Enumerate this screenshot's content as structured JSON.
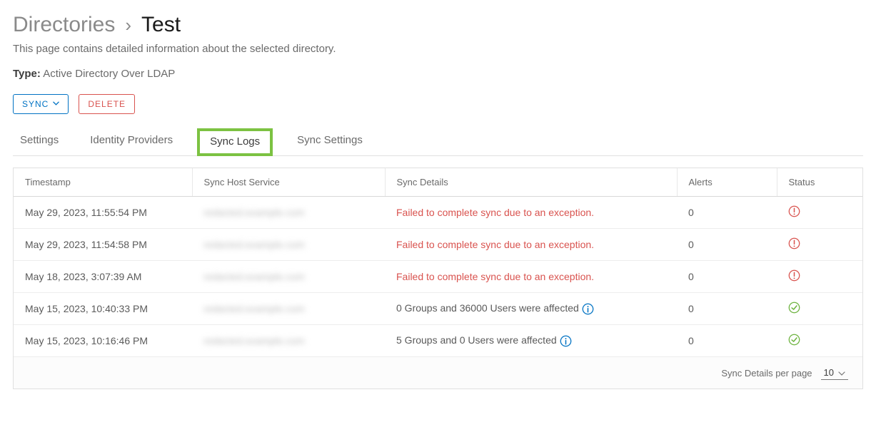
{
  "breadcrumb": {
    "parent": "Directories",
    "current": "Test"
  },
  "page_description": "This page contains detailed information about the selected directory.",
  "type_row": {
    "label": "Type:",
    "value": "Active Directory Over LDAP"
  },
  "actions": {
    "sync_label": "SYNC",
    "delete_label": "DELETE"
  },
  "tabs": {
    "settings": "Settings",
    "identity_providers": "Identity Providers",
    "sync_logs": "Sync Logs",
    "sync_settings": "Sync Settings"
  },
  "table": {
    "headers": {
      "timestamp": "Timestamp",
      "host": "Sync Host Service",
      "details": "Sync Details",
      "alerts": "Alerts",
      "status": "Status"
    },
    "rows": [
      {
        "timestamp": "May 29, 2023, 11:55:54 PM",
        "host": "redacted.example.com",
        "details": "Failed to complete sync due to an exception.",
        "details_type": "error",
        "alerts": "0",
        "status": "error"
      },
      {
        "timestamp": "May 29, 2023, 11:54:58 PM",
        "host": "redacted.example.com",
        "details": "Failed to complete sync due to an exception.",
        "details_type": "error",
        "alerts": "0",
        "status": "error"
      },
      {
        "timestamp": "May 18, 2023, 3:07:39 AM",
        "host": "redacted.example.com",
        "details": "Failed to complete sync due to an exception.",
        "details_type": "error",
        "alerts": "0",
        "status": "error"
      },
      {
        "timestamp": "May 15, 2023, 10:40:33 PM",
        "host": "redacted.example.com",
        "details": "0 Groups and 36000 Users were affected",
        "details_type": "info",
        "alerts": "0",
        "status": "ok"
      },
      {
        "timestamp": "May 15, 2023, 10:16:46 PM",
        "host": "redacted.example.com",
        "details": "5 Groups and 0 Users were affected",
        "details_type": "info",
        "alerts": "0",
        "status": "ok"
      }
    ]
  },
  "pager": {
    "label": "Sync Details per page",
    "value": "10"
  },
  "colors": {
    "error": "#d9534f",
    "ok": "#6db33f",
    "info": "#0072c3",
    "highlight": "#7cc242"
  }
}
